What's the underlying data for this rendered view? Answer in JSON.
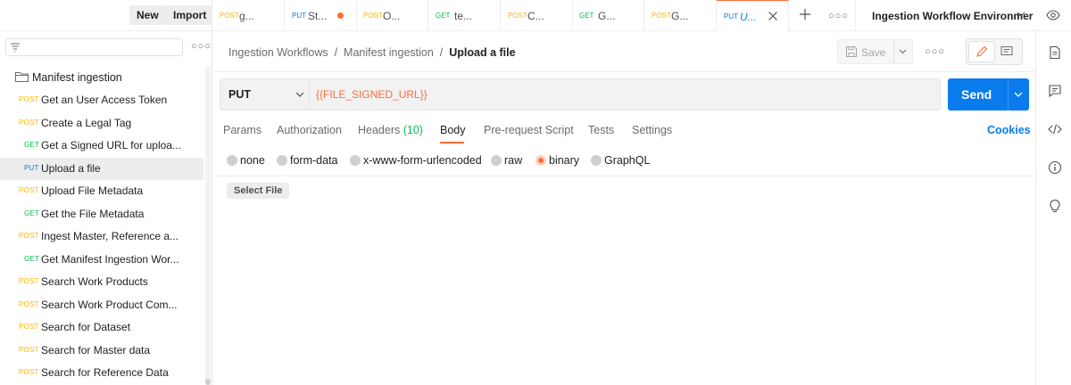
{
  "sidebar": {
    "new_label": "New",
    "import_label": "Import",
    "collection_name": "Manifest ingestion",
    "items": [
      {
        "method": "POST",
        "name": "Get an User Access Token"
      },
      {
        "method": "POST",
        "name": "Create a Legal Tag"
      },
      {
        "method": "GET",
        "name": "Get a Signed URL for uploa..."
      },
      {
        "method": "PUT",
        "name": "Upload a file",
        "active": true
      },
      {
        "method": "POST",
        "name": "Upload File Metadata"
      },
      {
        "method": "GET",
        "name": "Get the File Metadata"
      },
      {
        "method": "POST",
        "name": "Ingest Master, Reference a..."
      },
      {
        "method": "GET",
        "name": "Get Manifest Ingestion Wor..."
      },
      {
        "method": "POST",
        "name": "Search Work Products"
      },
      {
        "method": "POST",
        "name": "Search Work Product Com..."
      },
      {
        "method": "POST",
        "name": "Search for Dataset"
      },
      {
        "method": "POST",
        "name": "Search for Master data"
      },
      {
        "method": "POST",
        "name": "Search for Reference Data"
      }
    ]
  },
  "tabs": [
    {
      "method": "POST",
      "name": "g..."
    },
    {
      "method": "PUT",
      "name": "St...",
      "unsaved": true
    },
    {
      "method": "POST",
      "name": "O..."
    },
    {
      "method": "GET",
      "name": "te..."
    },
    {
      "method": "POST",
      "name": "C..."
    },
    {
      "method": "GET",
      "name": "G..."
    },
    {
      "method": "POST",
      "name": "G..."
    },
    {
      "method": "PUT",
      "name": "U...",
      "active": true
    }
  ],
  "environment": "Ingestion Workflow Environmer",
  "breadcrumb": {
    "part1": "Ingestion Workflows",
    "sep": "/",
    "part2": "Manifest ingestion",
    "current": "Upload a file"
  },
  "toolbar": {
    "save_label": "Save"
  },
  "request": {
    "method": "PUT",
    "url": "{{FILE_SIGNED_URL}}",
    "send_label": "Send"
  },
  "request_tabs": {
    "params": "Params",
    "authorization": "Authorization",
    "headers": "Headers",
    "headers_count": "(10)",
    "body": "Body",
    "prerequest": "Pre-request Script",
    "tests": "Tests",
    "settings": "Settings",
    "cookies": "Cookies"
  },
  "body_types": {
    "none": "none",
    "form_data": "form-data",
    "urlencoded": "x-www-form-urlencoded",
    "raw": "raw",
    "binary": "binary",
    "graphql": "GraphQL",
    "selected": "binary"
  },
  "select_file_label": "Select File",
  "colors": {
    "post": "#ffb400",
    "get": "#0cbb52",
    "put": "#097bed",
    "accent": "#ff6c37",
    "primary": "#097bed"
  }
}
